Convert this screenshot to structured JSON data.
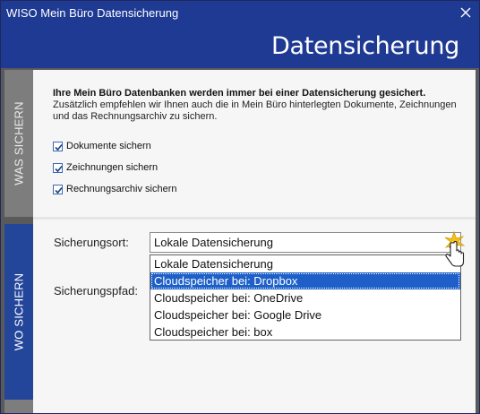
{
  "window": {
    "title": "WISO Mein Büro Datensicherung",
    "header": "Datensicherung"
  },
  "what_section": {
    "side_label": "WAS SICHERN",
    "intro_bold": "Ihre Mein Büro Datenbanken werden immer bei einer Datensicherung gesichert.",
    "intro_text": "Zusätzlich empfehlen wir Ihnen auch die in Mein Büro hinterlegten Dokumente, Zeichnungen und das Rechnungsarchiv zu sichern.",
    "checkboxes": [
      {
        "label": "Dokumente sichern",
        "checked": true
      },
      {
        "label": "Zeichnungen sichern",
        "checked": true
      },
      {
        "label": "Rechnungsarchiv sichern",
        "checked": true
      }
    ]
  },
  "where_section": {
    "side_label": "WO SICHERN",
    "location_label": "Sicherungsort:",
    "location_value": "Lokale Datensicherung",
    "path_label": "Sicherungspfad:",
    "options": [
      "Lokale Datensicherung",
      "Cloudspeicher bei: Dropbox",
      "Cloudspeicher bei: OneDrive",
      "Cloudspeicher bei: Google Drive",
      "Cloudspeicher bei: box"
    ],
    "selected_option": "Cloudspeicher bei: Dropbox"
  },
  "colors": {
    "accent": "#1f3a93",
    "selection": "#1e60c8",
    "side_inactive": "#7d7d7d"
  },
  "icons": {
    "close": "close-icon",
    "dropdown": "chevron-down-icon",
    "cursor": "hand-pointer-icon"
  }
}
